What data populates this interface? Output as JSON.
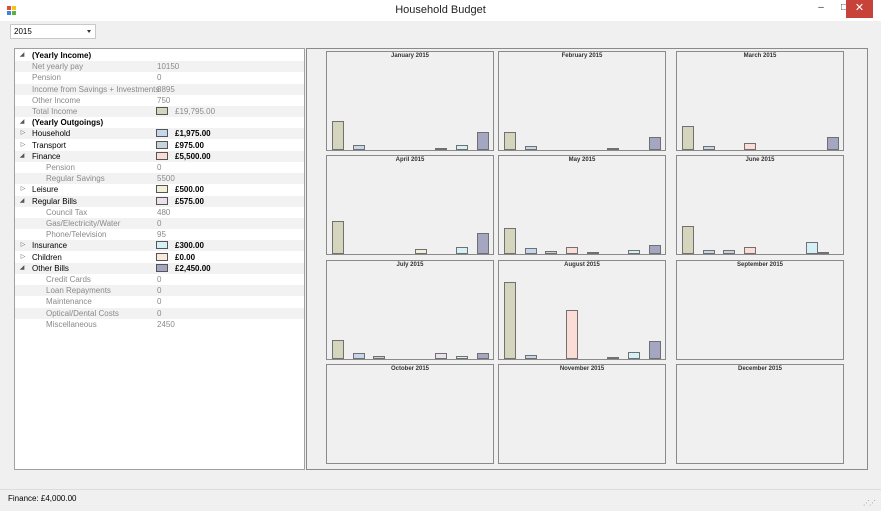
{
  "window": {
    "title": "Household Budget",
    "min_glyph": "–",
    "max_glyph": "□",
    "close_glyph": "✕"
  },
  "year_select": {
    "value": "2015"
  },
  "status_bar": {
    "text": "Finance: £4,000.00"
  },
  "colors": {
    "income": "#d5d4bd",
    "household": "#c6d7ec",
    "transport": "#c9d3dc",
    "finance": "#fbdcd6",
    "leisure": "#f3f0da",
    "regular_bills": "#ece0ea",
    "insurance": "#d3f1f6",
    "children": "#fbeadc",
    "other_bills": "#a5a6c2"
  },
  "tree": [
    {
      "label": "(Yearly Income)",
      "value": "",
      "level": 0,
      "style": "hdr",
      "expander": "open"
    },
    {
      "label": "Net yearly pay",
      "value": "10150",
      "level": 1,
      "style": "muted"
    },
    {
      "label": "Pension",
      "value": "0",
      "level": 1,
      "style": "muted"
    },
    {
      "label": "Income from Savings + Investments",
      "value": "8895",
      "level": 1,
      "style": "muted"
    },
    {
      "label": "Other Income",
      "value": "750",
      "level": 1,
      "style": "muted"
    },
    {
      "label": "Total Income",
      "value": "£19,795.00",
      "level": 1,
      "style": "muted",
      "swatch": "income"
    },
    {
      "label": "(Yearly Outgoings)",
      "value": "",
      "level": 0,
      "style": "hdr",
      "expander": "open"
    },
    {
      "label": "Household",
      "value": "£1,975.00",
      "level": 0,
      "style": "normal",
      "expander": "closed",
      "swatch": "household"
    },
    {
      "label": "Transport",
      "value": "£975.00",
      "level": 0,
      "style": "normal",
      "expander": "closed",
      "swatch": "transport"
    },
    {
      "label": "Finance",
      "value": "£5,500.00",
      "level": 0,
      "style": "normal",
      "expander": "open",
      "swatch": "finance"
    },
    {
      "label": "Pension",
      "value": "0",
      "level": 2,
      "style": "muted"
    },
    {
      "label": "Regular Savings",
      "value": "5500",
      "level": 2,
      "style": "muted"
    },
    {
      "label": "Leisure",
      "value": "£500.00",
      "level": 0,
      "style": "normal",
      "expander": "closed",
      "swatch": "leisure"
    },
    {
      "label": "Regular Bills",
      "value": "£575.00",
      "level": 0,
      "style": "normal",
      "expander": "open",
      "swatch": "regular_bills"
    },
    {
      "label": "Council Tax",
      "value": "480",
      "level": 2,
      "style": "muted"
    },
    {
      "label": "Gas/Electricity/Water",
      "value": "0",
      "level": 2,
      "style": "muted"
    },
    {
      "label": "Phone/Television",
      "value": "95",
      "level": 2,
      "style": "muted"
    },
    {
      "label": "Insurance",
      "value": "£300.00",
      "level": 0,
      "style": "normal",
      "expander": "closed",
      "swatch": "insurance"
    },
    {
      "label": "Children",
      "value": "£0.00",
      "level": 0,
      "style": "normal",
      "expander": "closed",
      "swatch": "children"
    },
    {
      "label": "Other Bills",
      "value": "£2,450.00",
      "level": 0,
      "style": "normal",
      "expander": "open",
      "swatch": "other_bills"
    },
    {
      "label": "Credit Cards",
      "value": "0",
      "level": 2,
      "style": "muted"
    },
    {
      "label": "Loan Repayments",
      "value": "0",
      "level": 2,
      "style": "muted"
    },
    {
      "label": "Maintenance",
      "value": "0",
      "level": 2,
      "style": "muted"
    },
    {
      "label": "Optical/Dental Costs",
      "value": "0",
      "level": 2,
      "style": "muted"
    },
    {
      "label": "Miscellaneous",
      "value": "2450",
      "level": 2,
      "style": "muted"
    }
  ],
  "chart_data": {
    "type": "bar",
    "categories": [
      "Income",
      "Household",
      "Transport",
      "Finance",
      "Leisure",
      "Regular Bills",
      "Insurance",
      "Children",
      "Other Bills"
    ],
    "months": [
      {
        "title": "January 2015",
        "values": [
          1650,
          300,
          0,
          0,
          0,
          100,
          300,
          0,
          1000
        ]
      },
      {
        "title": "February 2015",
        "values": [
          1050,
          250,
          0,
          0,
          0,
          80,
          0,
          0,
          750
        ]
      },
      {
        "title": "March 2015",
        "values": [
          1350,
          250,
          0,
          400,
          0,
          0,
          0,
          0,
          750
        ]
      },
      {
        "title": "April 2015",
        "values": [
          1850,
          0,
          0,
          0,
          300,
          0,
          400,
          0,
          1200
        ]
      },
      {
        "title": "May 2015",
        "values": [
          1500,
          350,
          150,
          400,
          100,
          0,
          200,
          0,
          500
        ]
      },
      {
        "title": "June 2015",
        "values": [
          1600,
          250,
          250,
          400,
          0,
          0,
          700,
          80,
          0
        ]
      },
      {
        "title": "July 2015",
        "values": [
          1100,
          350,
          150,
          0,
          0,
          350,
          150,
          0,
          350
        ]
      },
      {
        "title": "August 2015",
        "values": [
          4400,
          250,
          0,
          2800,
          0,
          50,
          400,
          0,
          1000
        ]
      },
      {
        "title": "September 2015",
        "values": []
      },
      {
        "title": "October 2015",
        "values": []
      },
      {
        "title": "November 2015",
        "values": []
      },
      {
        "title": "December 2015",
        "values": []
      }
    ],
    "ylim": [
      0,
      5000
    ]
  }
}
